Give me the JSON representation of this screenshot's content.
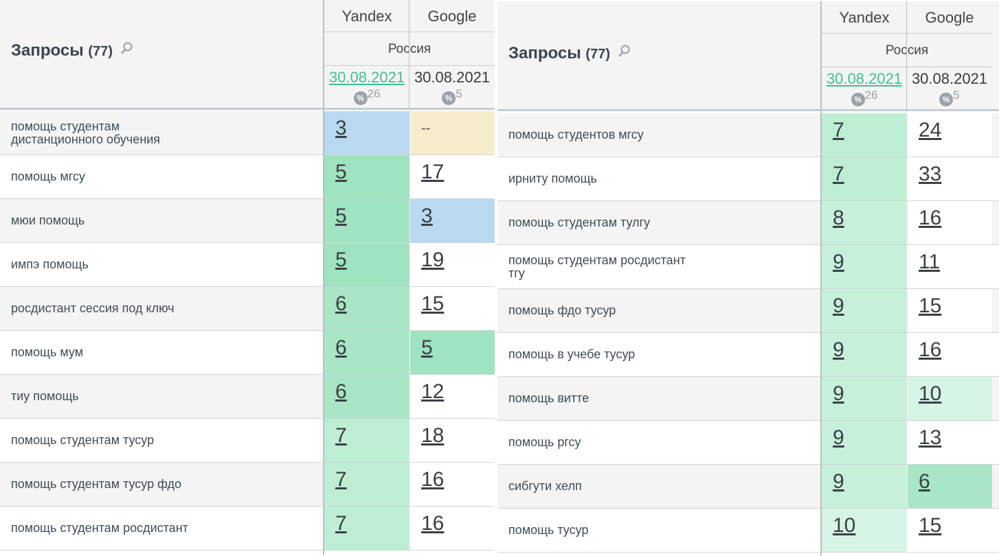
{
  "left": {
    "title": "Запросы",
    "count": "(77)",
    "engines": [
      "Yandex",
      "Google"
    ],
    "region": "Россия",
    "dates": [
      "30.08.2021",
      "30.08.2021"
    ],
    "pct_counts": [
      "26",
      "5"
    ],
    "rows": [
      {
        "kw": "помощь студентам\nдистанционного обучения",
        "y": "3",
        "g": "--",
        "yc": "bg-blue",
        "gc": "bg-yellow"
      },
      {
        "kw": "помощь мгсу",
        "y": "5",
        "g": "17",
        "yc": "bg-green1",
        "gc": "bg-white"
      },
      {
        "kw": "мюи помощь",
        "y": "5",
        "g": "3",
        "yc": "bg-green1",
        "gc": "bg-blue"
      },
      {
        "kw": "импэ помощь",
        "y": "5",
        "g": "19",
        "yc": "bg-green1",
        "gc": "bg-white"
      },
      {
        "kw": "росдистант сессия под ключ",
        "y": "6",
        "g": "15",
        "yc": "bg-green2",
        "gc": "bg-white"
      },
      {
        "kw": "помощь мум",
        "y": "6",
        "g": "5",
        "yc": "bg-green2",
        "gc": "bg-green1"
      },
      {
        "kw": "тиу помощь",
        "y": "6",
        "g": "12",
        "yc": "bg-green2",
        "gc": "bg-white"
      },
      {
        "kw": "помощь студентам тусур",
        "y": "7",
        "g": "18",
        "yc": "bg-green3",
        "gc": "bg-white"
      },
      {
        "kw": "помощь студентам тусур фдо",
        "y": "7",
        "g": "16",
        "yc": "bg-green3",
        "gc": "bg-white"
      },
      {
        "kw": "помощь студентам росдистант",
        "y": "7",
        "g": "16",
        "yc": "bg-green3",
        "gc": "bg-white"
      }
    ]
  },
  "right": {
    "title": "Запросы",
    "count": "(77)",
    "engines": [
      "Yandex",
      "Google"
    ],
    "region": "Россия",
    "dates": [
      "30.08.2021",
      "30.08.2021"
    ],
    "pct_counts": [
      "26",
      "5"
    ],
    "rows": [
      {
        "kw": "помощь студентов мгсу",
        "y": "7",
        "g": "24",
        "yc": "bg-green3",
        "gc": "bg-white"
      },
      {
        "kw": "ирниту помощь",
        "y": "7",
        "g": "33",
        "yc": "bg-green3",
        "gc": "bg-white"
      },
      {
        "kw": "помощь студентам тулгу",
        "y": "8",
        "g": "16",
        "yc": "bg-green4",
        "gc": "bg-white"
      },
      {
        "kw": "помощь студентам росдистант\nтгу",
        "y": "9",
        "g": "11",
        "yc": "bg-green4",
        "gc": "bg-white"
      },
      {
        "kw": "помощь фдо тусур",
        "y": "9",
        "g": "15",
        "yc": "bg-green4",
        "gc": "bg-white"
      },
      {
        "kw": "помощь в учебе тусур",
        "y": "9",
        "g": "16",
        "yc": "bg-green4",
        "gc": "bg-white"
      },
      {
        "kw": "помощь витте",
        "y": "9",
        "g": "10",
        "yc": "bg-green4",
        "gc": "bg-green5"
      },
      {
        "kw": "помощь ргсу",
        "y": "9",
        "g": "13",
        "yc": "bg-green4",
        "gc": "bg-white"
      },
      {
        "kw": "сибгути хелп",
        "y": "9",
        "g": "6",
        "yc": "bg-green4",
        "gc": "bg-green2"
      },
      {
        "kw": "помощь тусур",
        "y": "10",
        "g": "15",
        "yc": "bg-green5",
        "gc": "bg-white"
      }
    ]
  }
}
